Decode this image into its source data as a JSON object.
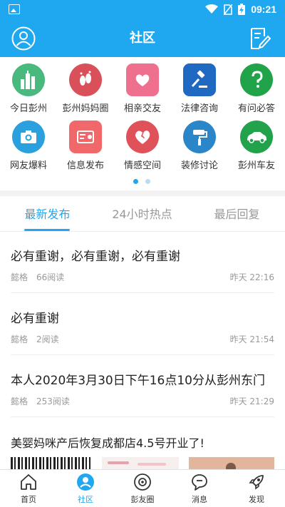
{
  "status_bar": {
    "time": "09:21"
  },
  "header": {
    "title": "社区"
  },
  "grid": {
    "items": [
      {
        "label": "今日彭州",
        "icon": "city-buildings-icon",
        "color": "#49b97e"
      },
      {
        "label": "彭州妈妈圈",
        "icon": "footprints-icon",
        "color": "#d9505b"
      },
      {
        "label": "相亲交友",
        "icon": "heart-cloud-icon",
        "color": "#ee6f8e"
      },
      {
        "label": "法律咨询",
        "icon": "gavel-icon",
        "color": "#1f69c2"
      },
      {
        "label": "有问必答",
        "icon": "question-icon",
        "color": "#21a34a"
      },
      {
        "label": "网友爆料",
        "icon": "camera-icon",
        "color": "#2aa0df"
      },
      {
        "label": "信息发布",
        "icon": "card-icon",
        "color": "#f0686a"
      },
      {
        "label": "情感空间",
        "icon": "broken-heart-icon",
        "color": "#e0525a"
      },
      {
        "label": "装修讨论",
        "icon": "paint-roller-icon",
        "color": "#2a86c9"
      },
      {
        "label": "彭州车友",
        "icon": "car-icon",
        "color": "#22a24a"
      }
    ]
  },
  "tabs": [
    {
      "label": "最新发布",
      "active": true
    },
    {
      "label": "24小时热点",
      "active": false
    },
    {
      "label": "最后回复",
      "active": false
    }
  ],
  "posts": [
    {
      "title": "必有重谢，必有重谢，必有重谢",
      "author": "懿格",
      "reads": "66阅读",
      "time": "昨天 22:16"
    },
    {
      "title": "必有重谢",
      "author": "懿格",
      "reads": "2阅读",
      "time": "昨天 21:54"
    },
    {
      "title": "本人2020年3月30日下午16点10分从彭州东门",
      "author": "懿格",
      "reads": "253阅读",
      "time": "昨天 21:29"
    },
    {
      "title": "美婴妈咪产后恢复成都店4.5号开业了!"
    }
  ],
  "bottom_nav": [
    {
      "label": "首页",
      "icon": "home-icon",
      "active": false
    },
    {
      "label": "社区",
      "icon": "community-icon",
      "active": true
    },
    {
      "label": "彭友圈",
      "icon": "circle-icon",
      "active": false
    },
    {
      "label": "消息",
      "icon": "message-icon",
      "active": false
    },
    {
      "label": "发现",
      "icon": "rocket-icon",
      "active": false
    }
  ],
  "colors": {
    "primary": "#1fa7f0",
    "text": "#222222",
    "muted": "#999999"
  }
}
